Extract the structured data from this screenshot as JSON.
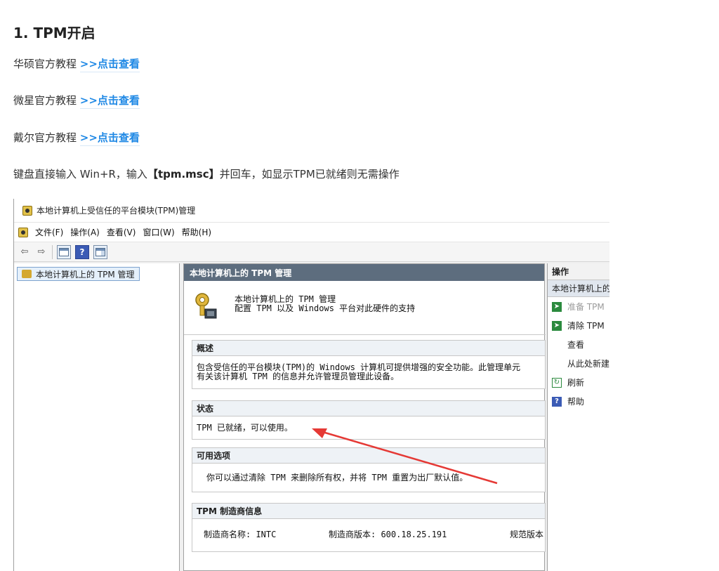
{
  "article": {
    "title": "1. TPM开启",
    "tutorials": [
      {
        "prefix": "华硕官方教程 ",
        "link": ">>点击查看"
      },
      {
        "prefix": "微星官方教程 ",
        "link": ">>点击查看"
      },
      {
        "prefix": "戴尔官方教程 ",
        "link": ">>点击查看"
      }
    ],
    "instruction": {
      "part1": "键盘直接输入 Win+R，输入",
      "command": "【tpm.msc】",
      "part2": "并回车，如显示TPM已就绪则无需操作"
    }
  },
  "mmc": {
    "title": "本地计算机上受信任的平台模块(TPM)管理",
    "menu": [
      "文件(F)",
      "操作(A)",
      "查看(V)",
      "窗口(W)",
      "帮助(H)"
    ],
    "toolbar_icons": [
      "back-icon",
      "forward-icon",
      "console-tree-icon",
      "help-icon",
      "action-pane-icon"
    ],
    "tree_item": "本地计算机上的 TPM 管理",
    "mid_header": "本地计算机上的 TPM 管理",
    "intro_line1": "本地计算机上的 TPM 管理",
    "intro_line2": "配置 TPM 以及 Windows 平台对此硬件的支持",
    "overview": {
      "head": "概述",
      "line1": "包含受信任的平台模块(TPM)的 Windows 计算机可提供增强的安全功能。此管理单元",
      "line2": "有关该计算机 TPM 的信息并允许管理员管理此设备。"
    },
    "status": {
      "head": "状态",
      "text": "TPM 已就绪，可以使用。"
    },
    "options": {
      "head": "可用选项",
      "text": "你可以通过清除 TPM 来删除所有权，并将 TPM 重置为出厂默认值。"
    },
    "manufacturer": {
      "head": "TPM 制造商信息",
      "name_label": "制造商名称: INTC",
      "version_label": "制造商版本: 600.18.25.191",
      "spec_label": "规范版本"
    },
    "actions": {
      "head": "操作",
      "sub": "本地计算机上的 TPM 管理",
      "items": [
        {
          "label": "准备 TPM",
          "icon": "green-arrow-icon",
          "disabled": true
        },
        {
          "label": "清除 TPM",
          "icon": "green-arrow-icon",
          "disabled": false
        },
        {
          "label": "查看",
          "icon": "",
          "disabled": false
        },
        {
          "label": "从此处新建窗口",
          "icon": "",
          "disabled": false
        },
        {
          "label": "刷新",
          "icon": "refresh-icon",
          "disabled": false
        },
        {
          "label": "帮助",
          "icon": "help-icon",
          "disabled": false
        }
      ]
    },
    "annotation_arrow_color": "#e53935"
  }
}
